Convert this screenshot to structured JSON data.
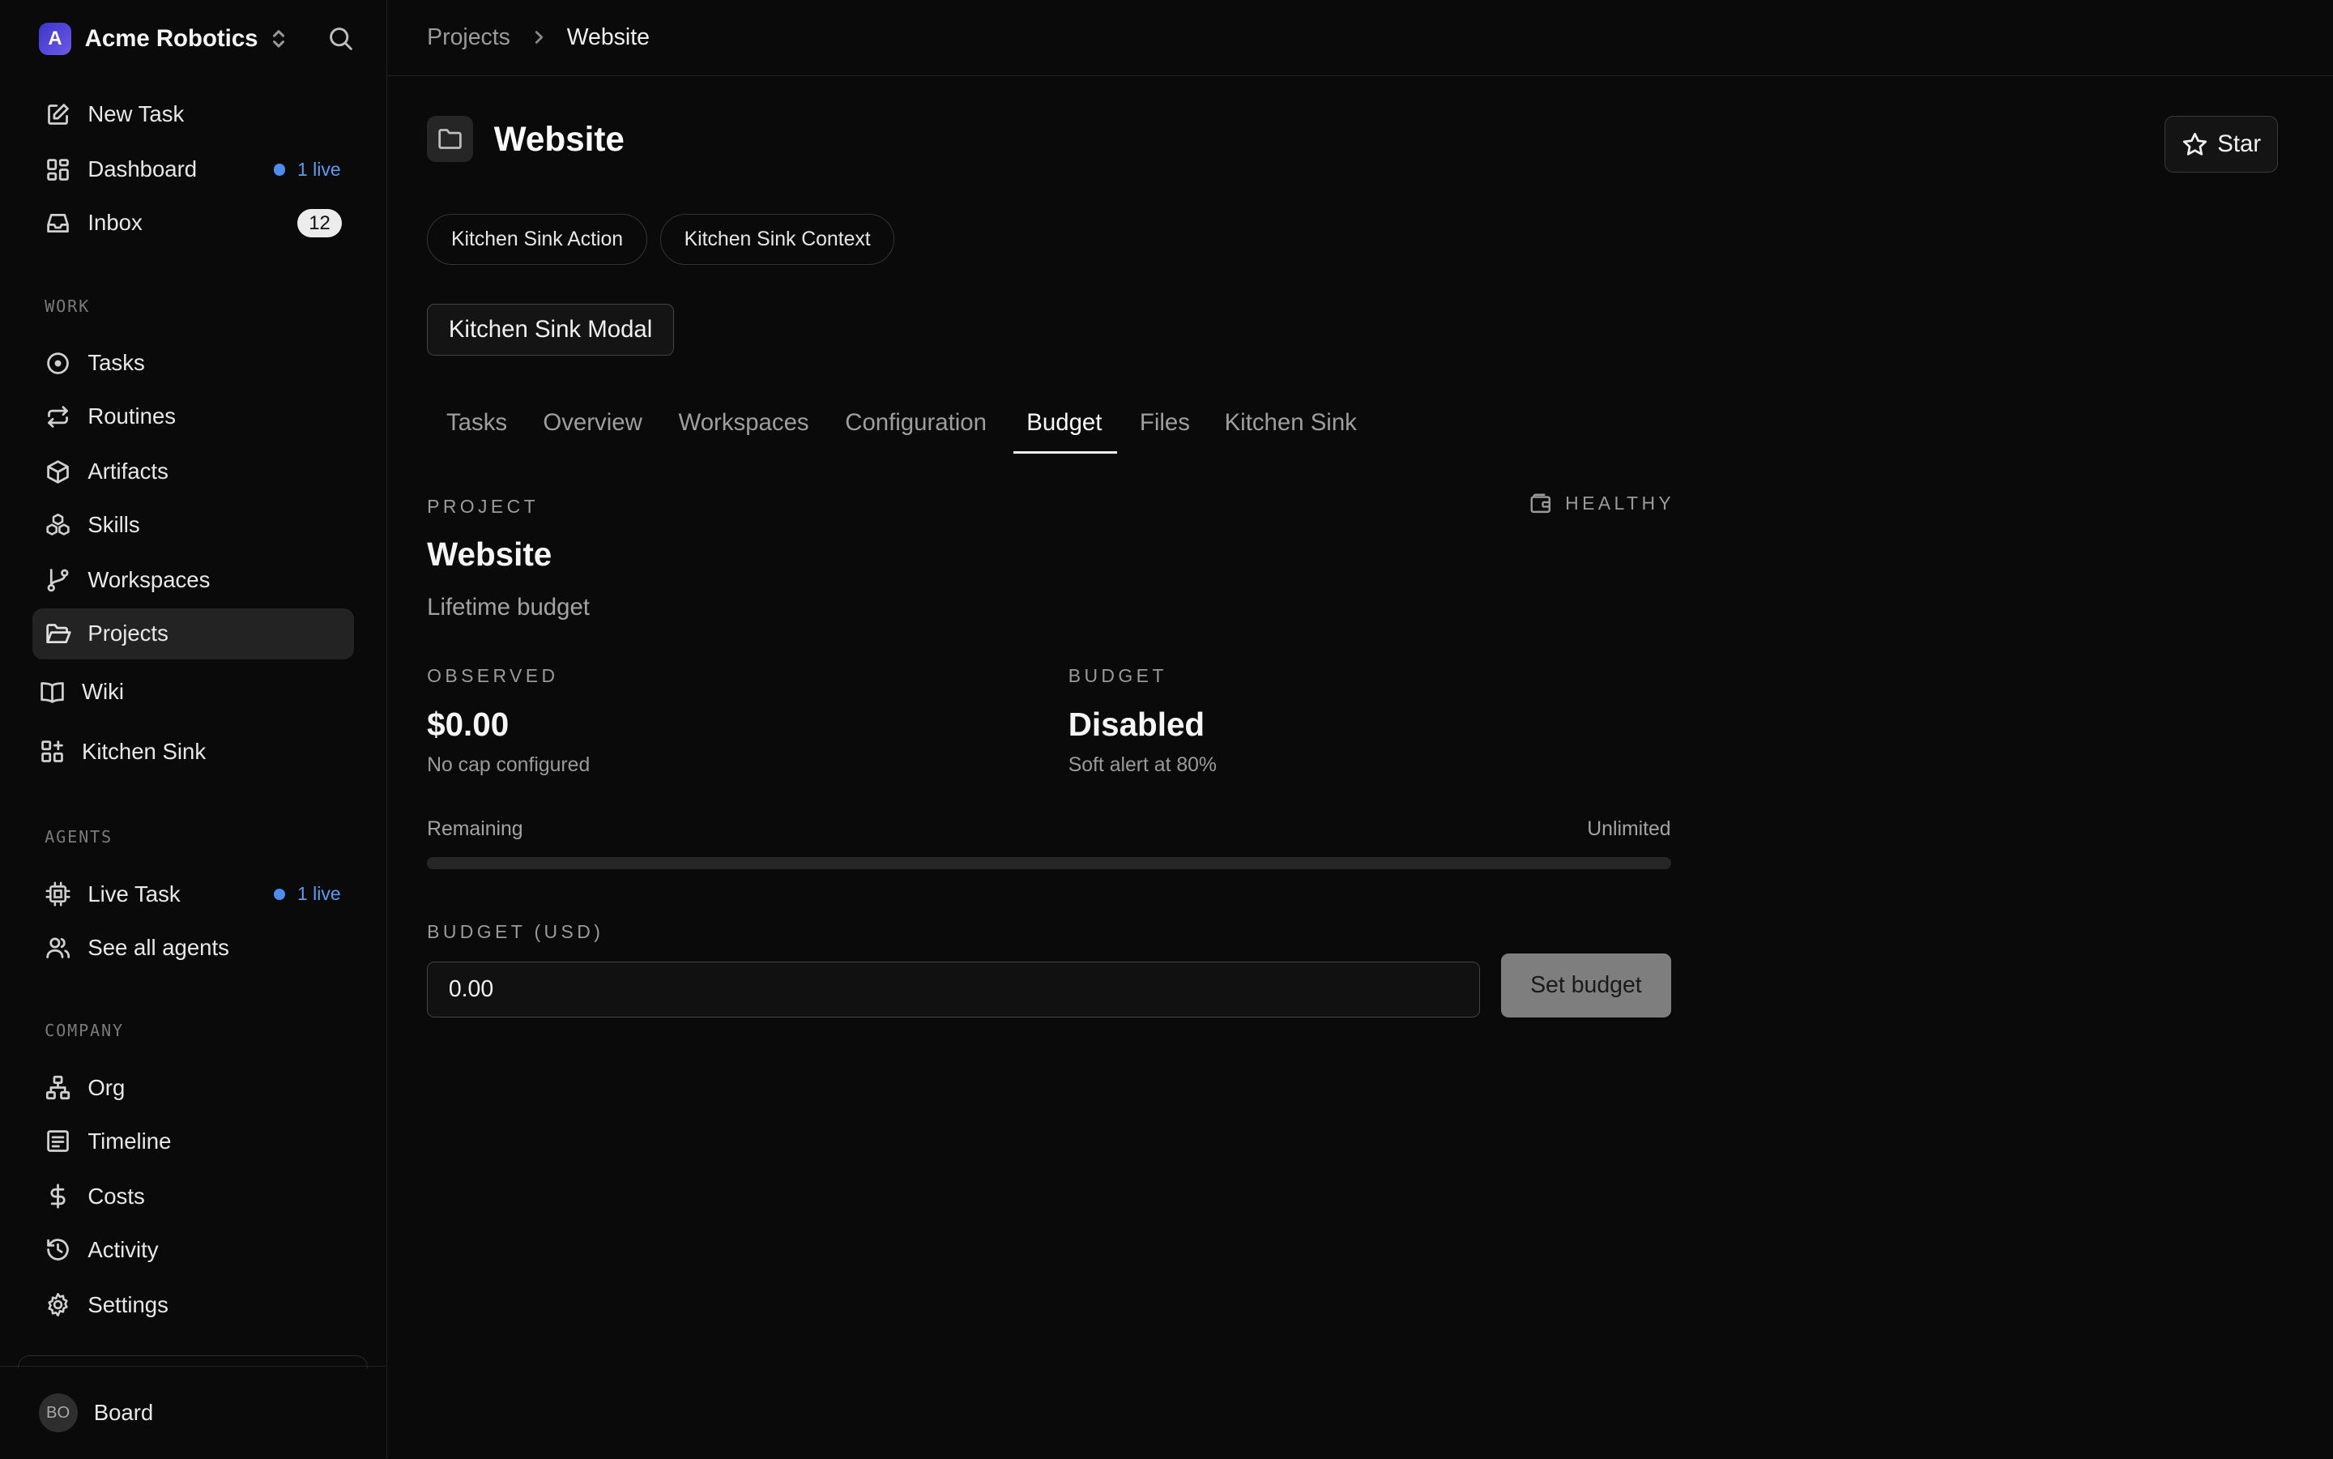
{
  "sidebar": {
    "brand": {
      "logo_letter": "A",
      "name": "Acme Robotics"
    },
    "top_items": [
      {
        "label": "New Task",
        "icon": "pencil-square-icon"
      },
      {
        "label": "Dashboard",
        "icon": "dashboard-icon",
        "live": "1 live"
      },
      {
        "label": "Inbox",
        "icon": "inbox-icon",
        "count": "12"
      }
    ],
    "sections": {
      "work": "WORK",
      "agents": "AGENTS",
      "company": "COMPANY"
    },
    "work_items": [
      {
        "label": "Tasks",
        "icon": "circle-dot-icon"
      },
      {
        "label": "Routines",
        "icon": "repeat-icon"
      },
      {
        "label": "Artifacts",
        "icon": "box-icon"
      },
      {
        "label": "Skills",
        "icon": "boxes-icon"
      },
      {
        "label": "Workspaces",
        "icon": "git-branch-icon"
      },
      {
        "label": "Projects",
        "icon": "folder-open-icon",
        "active": true
      },
      {
        "label": "Wiki",
        "icon": "book-icon"
      },
      {
        "label": "Kitchen Sink",
        "icon": "grid-plus-icon"
      }
    ],
    "agent_items": [
      {
        "label": "Live Task",
        "icon": "cpu-icon",
        "live": "1 live"
      },
      {
        "label": "See all agents",
        "icon": "users-icon"
      }
    ],
    "company_items": [
      {
        "label": "Org",
        "icon": "org-chart-icon"
      },
      {
        "label": "Timeline",
        "icon": "timeline-icon"
      },
      {
        "label": "Costs",
        "icon": "dollar-icon"
      },
      {
        "label": "Activity",
        "icon": "history-icon"
      },
      {
        "label": "Settings",
        "icon": "gear-icon"
      }
    ],
    "footer": {
      "initials": "BO",
      "name": "Board"
    }
  },
  "breadcrumb": {
    "parent": "Projects",
    "current": "Website"
  },
  "header": {
    "title": "Website",
    "star_label": "Star"
  },
  "actions": {
    "pill_action": "Kitchen Sink Action",
    "pill_context": "Kitchen Sink Context",
    "modal_label": "Kitchen Sink Modal"
  },
  "tabs": [
    "Tasks",
    "Overview",
    "Workspaces",
    "Configuration",
    "Budget",
    "Files",
    "Kitchen Sink"
  ],
  "active_tab": "Budget",
  "budget": {
    "project_eyebrow": "PROJECT",
    "status": "HEALTHY",
    "project_name": "Website",
    "lifetime_label": "Lifetime budget",
    "observed_eyebrow": "OBSERVED",
    "observed_value": "$0.00",
    "observed_note": "No cap configured",
    "budget_eyebrow": "BUDGET",
    "budget_value": "Disabled",
    "budget_note": "Soft alert at 80%",
    "remaining_label": "Remaining",
    "remaining_value": "Unlimited",
    "progress_fraction": 0,
    "input_label": "BUDGET (USD)",
    "input_value": "0.00",
    "set_button": "Set budget"
  },
  "colors": {
    "accent_blue": "#4c8df0",
    "background": "#0a0a0a"
  }
}
